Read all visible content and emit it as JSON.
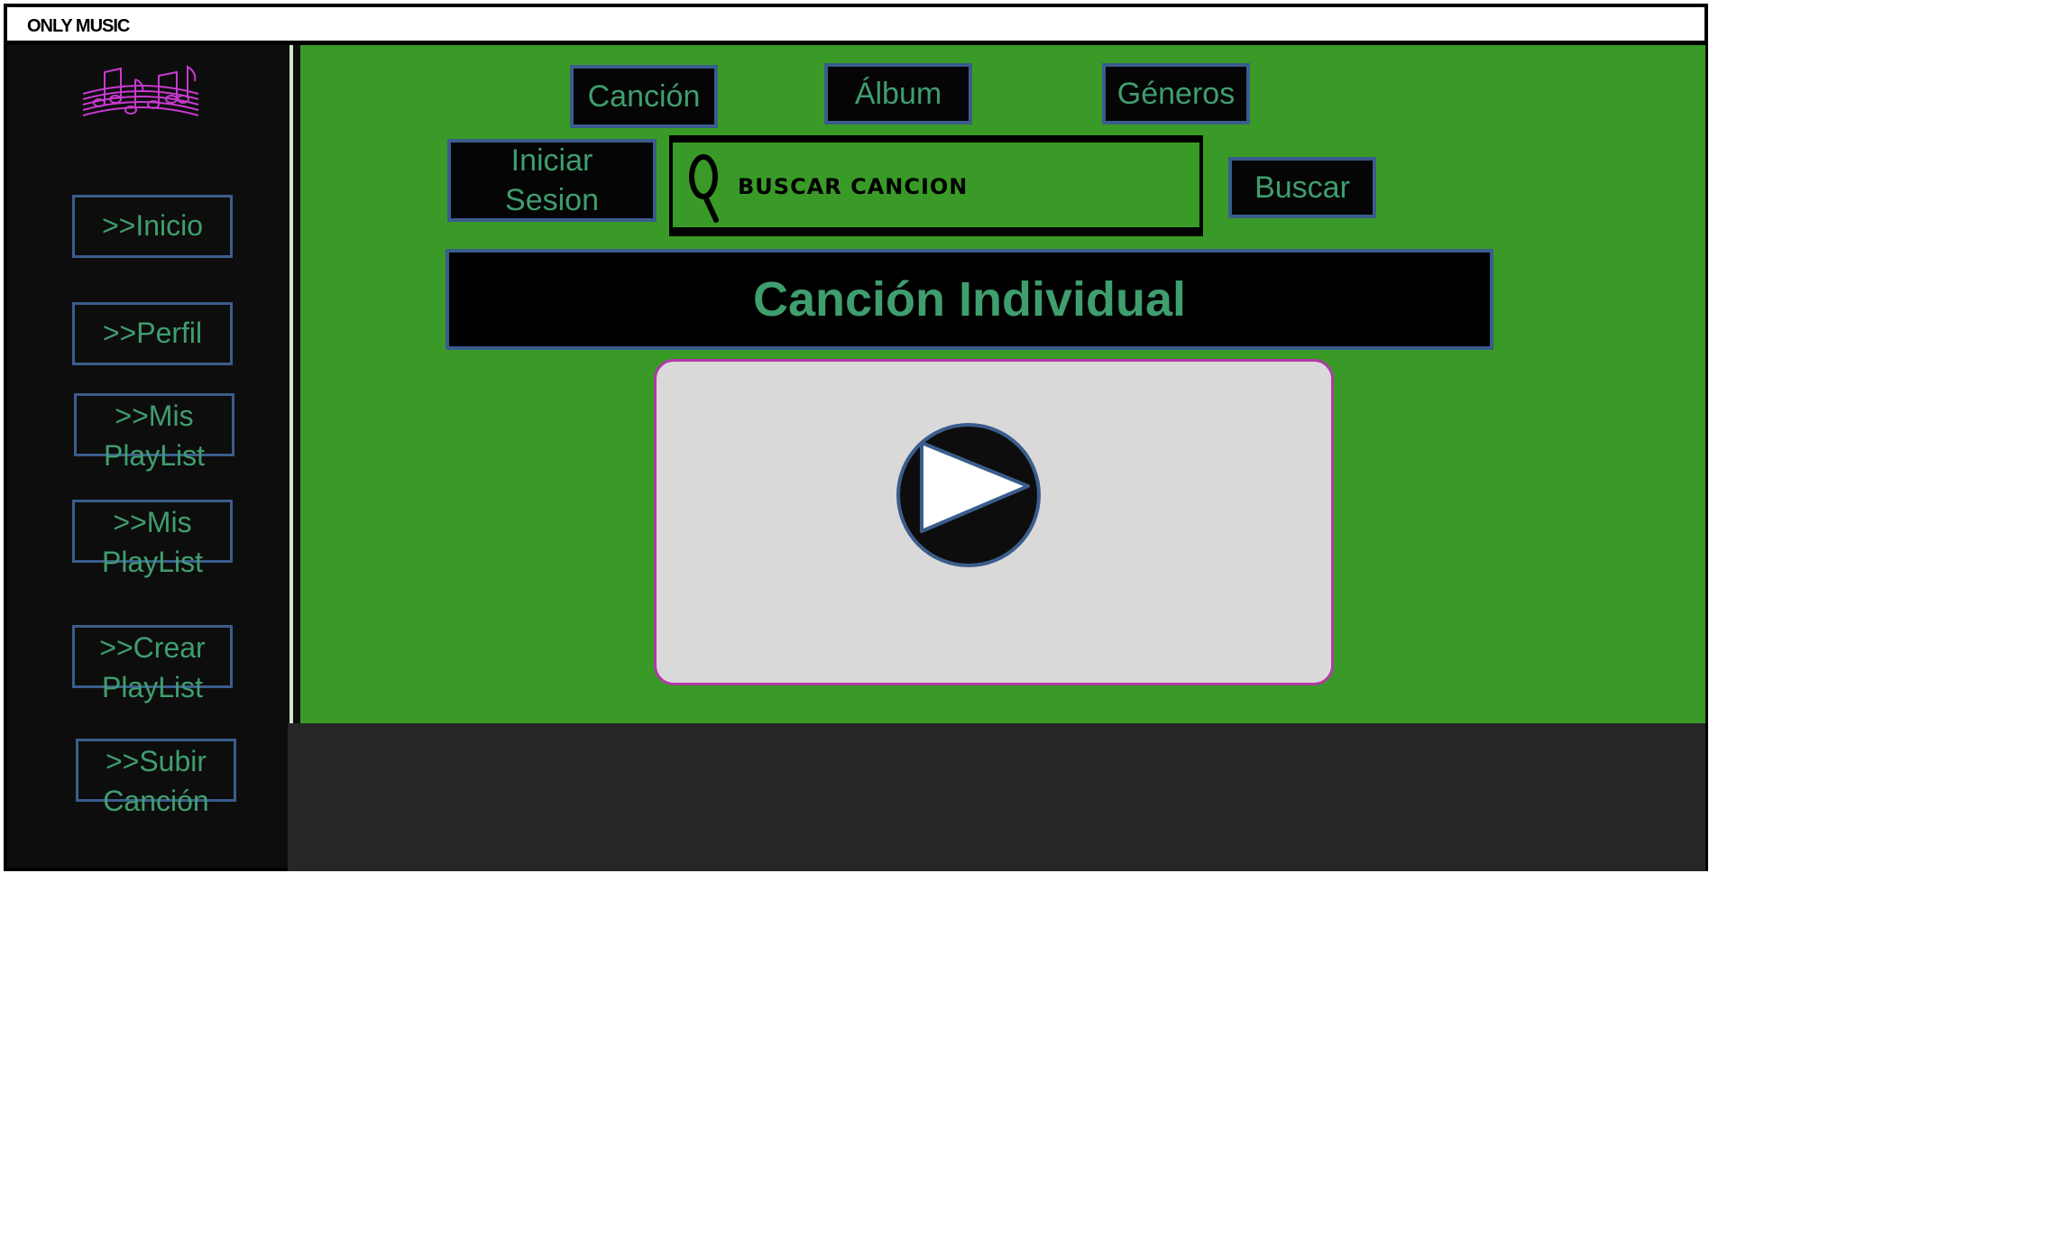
{
  "app": {
    "title": "ONLY MUSIC"
  },
  "sidebar": {
    "logo_icon": "music-staff-notes-icon",
    "items": [
      {
        "label": ">>Inicio"
      },
      {
        "label": ">>Perfil"
      },
      {
        "label": ">>Mis PlayList"
      },
      {
        "label": ">>Mis PlayList"
      },
      {
        "label": ">>Crear PlayList"
      },
      {
        "label": ">>Subir Canción"
      }
    ]
  },
  "nav": {
    "tabs": [
      {
        "label": "Canción"
      },
      {
        "label": "Álbum"
      },
      {
        "label": "Géneros"
      }
    ],
    "login_label": "Iniciar Sesion",
    "search_button_label": "Buscar"
  },
  "search": {
    "placeholder": "BUSCAR CANCION",
    "icon": "search-icon"
  },
  "main": {
    "title": "Canción Individual"
  },
  "player": {
    "icon": "play-icon"
  },
  "colors": {
    "main_bg": "#3a9a27",
    "sidebar_bg": "#0d0d0d",
    "button_text": "#3f9e6e",
    "button_border": "#3a5d8c",
    "logo": "#c83ad0",
    "player_border": "#b03aa8"
  }
}
